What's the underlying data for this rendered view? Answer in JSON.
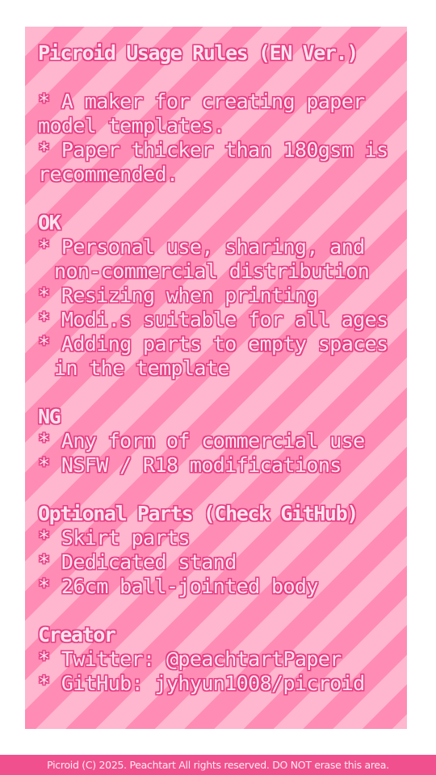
{
  "rules": {
    "title": "Picroid Usage Rules (EN Ver.)",
    "intro": [
      "* A maker for creating paper",
      "model templates.",
      "* Paper thicker than 180gsm is",
      "recommended."
    ],
    "ok": {
      "heading": "OK",
      "lines": [
        "* Personal use, sharing, and",
        "non-commercial distribution",
        "* Resizing when printing",
        "* Modi.s suitable for all ages",
        "* Adding parts to empty spaces",
        "in the template"
      ]
    },
    "ng": {
      "heading": "NG",
      "lines": [
        "* Any form of commercial use",
        "* NSFW / R18 modifications"
      ]
    },
    "optional": {
      "heading": "Optional Parts (Check GitHub)",
      "lines": [
        "* Skirt parts",
        "* Dedicated stand",
        "* 26cm ball-jointed body"
      ]
    },
    "creator": {
      "heading": "Creator",
      "lines": [
        "* Twitter: @peachtartPaper",
        "* GitHub: jyhyun1008/picroid"
      ]
    }
  },
  "footer": {
    "text": "Picroid (C) 2025. Peachtart All rights reserved. DO NOT erase this area."
  },
  "colors": {
    "stripe_light": "#ffb6cf",
    "stripe_dark": "#ff8cb4",
    "text_fill": "#ffe3ee",
    "text_outline": "#e63d83",
    "footer_bg": "#f0508e"
  }
}
